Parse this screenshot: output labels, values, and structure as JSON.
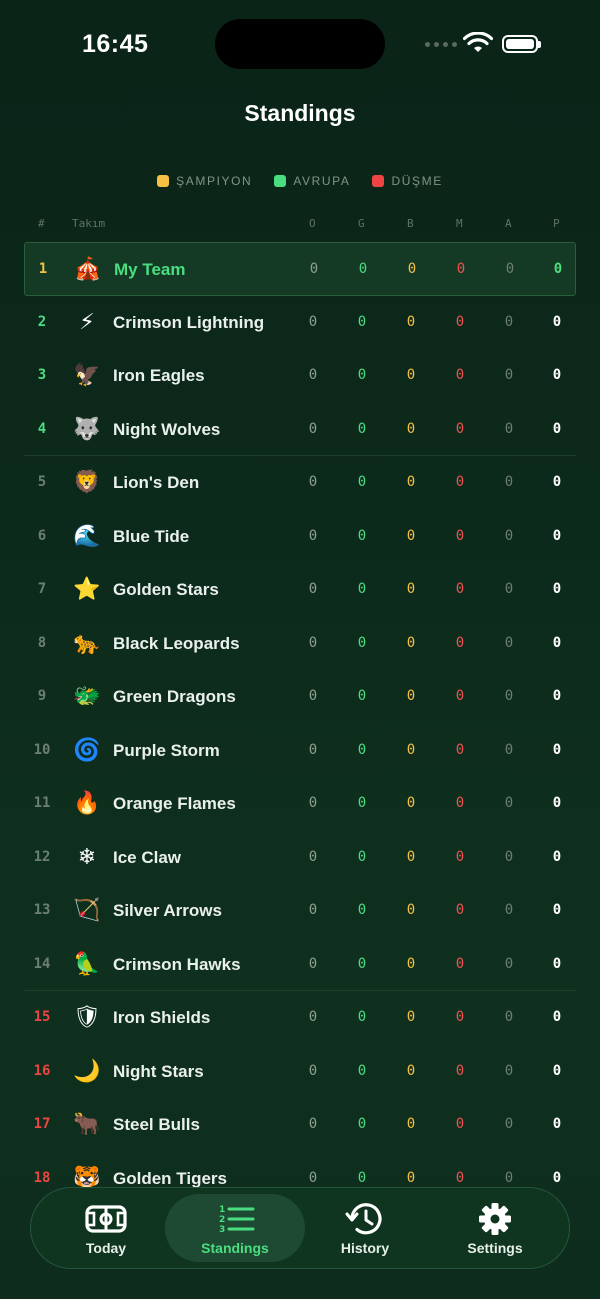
{
  "status": {
    "time": "16:45"
  },
  "title": "Standings",
  "legend": [
    {
      "label": "ŞAMPIYON",
      "color": "#f5c044"
    },
    {
      "label": "AVRUPA",
      "color": "#4ade80"
    },
    {
      "label": "DÜŞME",
      "color": "#ef4444"
    }
  ],
  "columns": {
    "rank": "#",
    "team": "Takım",
    "o": "O",
    "g": "G",
    "b": "B",
    "m": "M",
    "a": "A",
    "p": "P"
  },
  "rows": [
    {
      "rank": "1",
      "emoji": "🎪",
      "name": "My Team",
      "o": "0",
      "g": "0",
      "b": "0",
      "m": "0",
      "a": "0",
      "p": "0"
    },
    {
      "rank": "2",
      "emoji": "⚡",
      "name": "Crimson Lightning",
      "o": "0",
      "g": "0",
      "b": "0",
      "m": "0",
      "a": "0",
      "p": "0"
    },
    {
      "rank": "3",
      "emoji": "🦅",
      "name": "Iron Eagles",
      "o": "0",
      "g": "0",
      "b": "0",
      "m": "0",
      "a": "0",
      "p": "0"
    },
    {
      "rank": "4",
      "emoji": "🐺",
      "name": "Night Wolves",
      "o": "0",
      "g": "0",
      "b": "0",
      "m": "0",
      "a": "0",
      "p": "0"
    },
    {
      "rank": "5",
      "emoji": "🦁",
      "name": "Lion's Den",
      "o": "0",
      "g": "0",
      "b": "0",
      "m": "0",
      "a": "0",
      "p": "0"
    },
    {
      "rank": "6",
      "emoji": "🌊",
      "name": "Blue Tide",
      "o": "0",
      "g": "0",
      "b": "0",
      "m": "0",
      "a": "0",
      "p": "0"
    },
    {
      "rank": "7",
      "emoji": "⭐",
      "name": "Golden Stars",
      "o": "0",
      "g": "0",
      "b": "0",
      "m": "0",
      "a": "0",
      "p": "0"
    },
    {
      "rank": "8",
      "emoji": "🐆",
      "name": "Black Leopards",
      "o": "0",
      "g": "0",
      "b": "0",
      "m": "0",
      "a": "0",
      "p": "0"
    },
    {
      "rank": "9",
      "emoji": "🐲",
      "name": "Green Dragons",
      "o": "0",
      "g": "0",
      "b": "0",
      "m": "0",
      "a": "0",
      "p": "0"
    },
    {
      "rank": "10",
      "emoji": "🌀",
      "name": "Purple Storm",
      "o": "0",
      "g": "0",
      "b": "0",
      "m": "0",
      "a": "0",
      "p": "0"
    },
    {
      "rank": "11",
      "emoji": "🔥",
      "name": "Orange Flames",
      "o": "0",
      "g": "0",
      "b": "0",
      "m": "0",
      "a": "0",
      "p": "0"
    },
    {
      "rank": "12",
      "emoji": "❄",
      "name": "Ice Claw",
      "o": "0",
      "g": "0",
      "b": "0",
      "m": "0",
      "a": "0",
      "p": "0"
    },
    {
      "rank": "13",
      "emoji": "🏹",
      "name": "Silver Arrows",
      "o": "0",
      "g": "0",
      "b": "0",
      "m": "0",
      "a": "0",
      "p": "0"
    },
    {
      "rank": "14",
      "emoji": "🦜",
      "name": "Crimson Hawks",
      "o": "0",
      "g": "0",
      "b": "0",
      "m": "0",
      "a": "0",
      "p": "0"
    },
    {
      "rank": "15",
      "emoji": "🛡",
      "name": "Iron Shields",
      "o": "0",
      "g": "0",
      "b": "0",
      "m": "0",
      "a": "0",
      "p": "0"
    },
    {
      "rank": "16",
      "emoji": "🌙",
      "name": "Night Stars",
      "o": "0",
      "g": "0",
      "b": "0",
      "m": "0",
      "a": "0",
      "p": "0"
    },
    {
      "rank": "17",
      "emoji": "🐂",
      "name": "Steel Bulls",
      "o": "0",
      "g": "0",
      "b": "0",
      "m": "0",
      "a": "0",
      "p": "0"
    },
    {
      "rank": "18",
      "emoji": "🐯",
      "name": "Golden Tigers",
      "o": "0",
      "g": "0",
      "b": "0",
      "m": "0",
      "a": "0",
      "p": "0"
    }
  ],
  "rank_colors": {
    "champion": "#f5c044",
    "europe": "#4ade80",
    "normal": "#6d7f73",
    "relegation": "#ef4444"
  },
  "tabs": [
    {
      "label": "Today",
      "icon": "field-icon",
      "active": false
    },
    {
      "label": "Standings",
      "icon": "list-icon",
      "active": true
    },
    {
      "label": "History",
      "icon": "history-icon",
      "active": false
    },
    {
      "label": "Settings",
      "icon": "gear-icon",
      "active": false
    }
  ]
}
